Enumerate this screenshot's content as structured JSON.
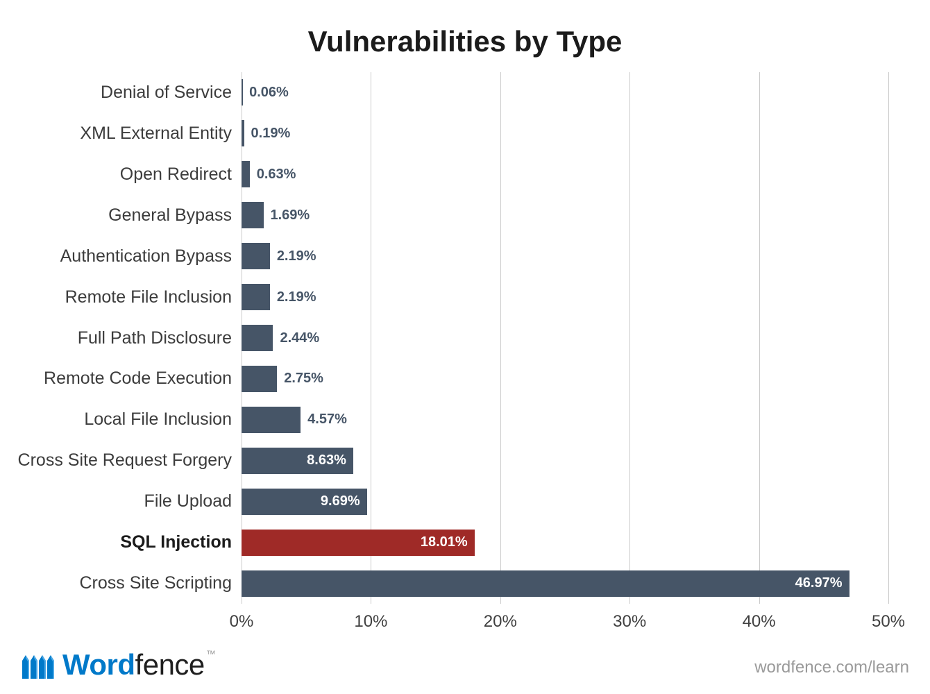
{
  "title": "Vulnerabilities by Type",
  "brand": {
    "word1": "Word",
    "word2": "fence"
  },
  "footer_url": "wordfence.com/learn",
  "xticks": [
    "0%",
    "10%",
    "20%",
    "30%",
    "40%",
    "50%"
  ],
  "bars": [
    {
      "label": "Denial of Service",
      "value": 0.06,
      "value_label": "0.06%",
      "highlight": false
    },
    {
      "label": "XML External Entity",
      "value": 0.19,
      "value_label": "0.19%",
      "highlight": false
    },
    {
      "label": "Open Redirect",
      "value": 0.63,
      "value_label": "0.63%",
      "highlight": false
    },
    {
      "label": "General Bypass",
      "value": 1.69,
      "value_label": "1.69%",
      "highlight": false
    },
    {
      "label": "Authentication Bypass",
      "value": 2.19,
      "value_label": "2.19%",
      "highlight": false
    },
    {
      "label": "Remote File Inclusion",
      "value": 2.19,
      "value_label": "2.19%",
      "highlight": false
    },
    {
      "label": "Full Path Disclosure",
      "value": 2.44,
      "value_label": "2.44%",
      "highlight": false
    },
    {
      "label": "Remote Code Execution",
      "value": 2.75,
      "value_label": "2.75%",
      "highlight": false
    },
    {
      "label": "Local File Inclusion",
      "value": 4.57,
      "value_label": "4.57%",
      "highlight": false
    },
    {
      "label": "Cross Site Request Forgery",
      "value": 8.63,
      "value_label": "8.63%",
      "highlight": false
    },
    {
      "label": "File Upload",
      "value": 9.69,
      "value_label": "9.69%",
      "highlight": false
    },
    {
      "label": "SQL Injection",
      "value": 18.01,
      "value_label": "18.01%",
      "highlight": true
    },
    {
      "label": "Cross Site Scripting",
      "value": 46.97,
      "value_label": "46.97%",
      "highlight": false
    }
  ],
  "chart_data": {
    "type": "bar",
    "orientation": "horizontal",
    "title": "Vulnerabilities by Type",
    "xlabel": "",
    "ylabel": "",
    "xlim": [
      0,
      50
    ],
    "x_tick_labels": [
      "0%",
      "10%",
      "20%",
      "30%",
      "40%",
      "50%"
    ],
    "categories": [
      "Denial of Service",
      "XML External Entity",
      "Open Redirect",
      "General Bypass",
      "Authentication Bypass",
      "Remote File Inclusion",
      "Full Path Disclosure",
      "Remote Code Execution",
      "Local File Inclusion",
      "Cross Site Request Forgery",
      "File Upload",
      "SQL Injection",
      "Cross Site Scripting"
    ],
    "values": [
      0.06,
      0.19,
      0.63,
      1.69,
      2.19,
      2.19,
      2.44,
      2.75,
      4.57,
      8.63,
      9.69,
      18.01,
      46.97
    ],
    "value_format": "percent",
    "highlight_category": "SQL Injection",
    "colors": {
      "default": "#465567",
      "highlight": "#9f2a27"
    }
  }
}
